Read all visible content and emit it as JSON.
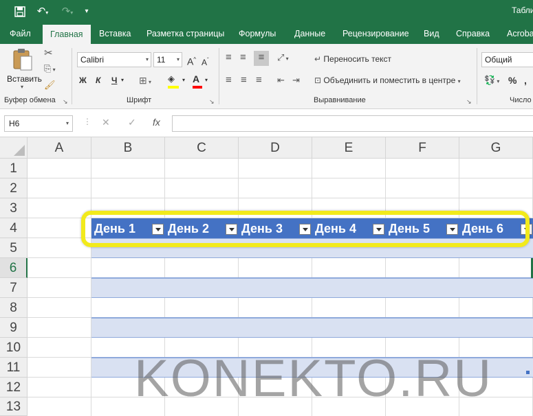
{
  "title_bar": {
    "title": "Табли",
    "icons": [
      "save-icon",
      "undo-icon",
      "redo-icon",
      "customize-icon"
    ]
  },
  "ribbon_tabs": [
    "Файл",
    "Главная",
    "Вставка",
    "Разметка страницы",
    "Формулы",
    "Данные",
    "Рецензирование",
    "Вид",
    "Справка",
    "Acrobat"
  ],
  "active_tab": "Главная",
  "clipboard": {
    "paste_label": "Вставить",
    "group_label": "Буфер обмена"
  },
  "font": {
    "name": "Calibri",
    "size": "11",
    "bold": "Ж",
    "italic": "К",
    "underline": "Ч",
    "grow": "A",
    "shrink": "A",
    "font_color_glyph": "A",
    "group_label": "Шрифт"
  },
  "alignment": {
    "wrap_text": "Переносить текст",
    "merge_center": "Объединить и поместить в центре",
    "group_label": "Выравнивание"
  },
  "number": {
    "format": "Общий",
    "percent": "%",
    "group_label": "Число"
  },
  "formula_bar": {
    "name_box": "H6",
    "cancel": "✕",
    "enter": "✓",
    "fx": "fx",
    "value": ""
  },
  "columns": [
    "A",
    "B",
    "C",
    "D",
    "E",
    "F",
    "G"
  ],
  "rows": [
    "1",
    "2",
    "3",
    "4",
    "5",
    "6",
    "7",
    "8",
    "9",
    "10",
    "11",
    "12",
    "13"
  ],
  "selected_row": "6",
  "table_headers": [
    "День 1",
    "День 2",
    "День 3",
    "День 4",
    "День 5",
    "День 6"
  ],
  "colors": {
    "excel_green": "#217346",
    "table_header": "#4472c4",
    "band": "#d9e1f2",
    "highlight": "#f2ea1c"
  },
  "watermark": "KONEKTO.RU"
}
